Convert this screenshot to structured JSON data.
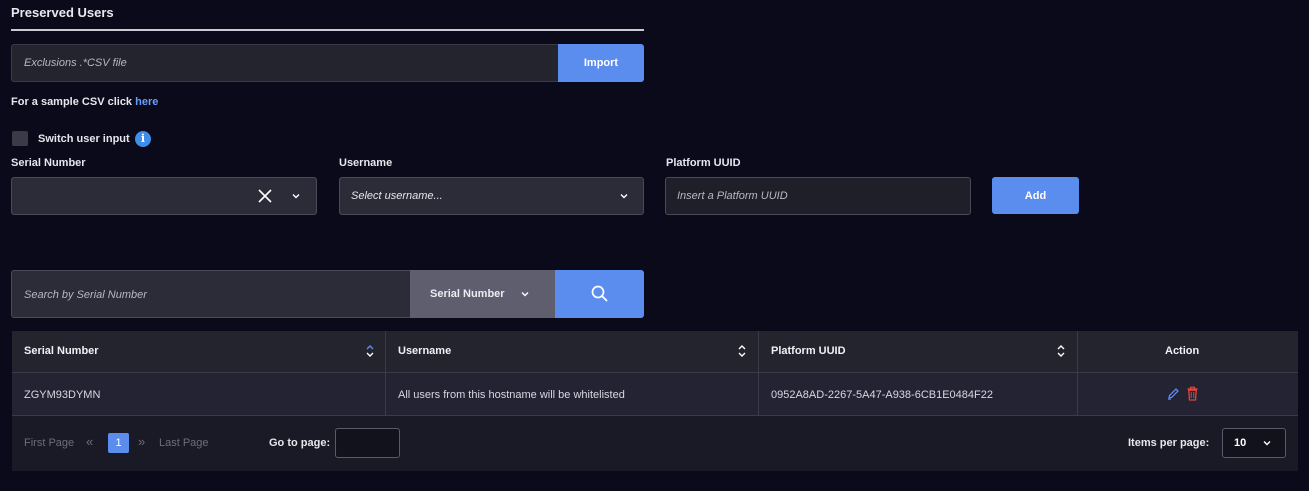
{
  "section": {
    "title": "Preserved Users"
  },
  "import": {
    "file_placeholder": "Exclusions .*CSV file",
    "button_label": "Import",
    "sample_text": "For a sample CSV click",
    "sample_link": "here"
  },
  "switch_input": {
    "label": "Switch user input",
    "checked": false,
    "info_icon": "info-icon"
  },
  "form": {
    "serial_label": "Serial Number",
    "serial_value": "",
    "username_label": "Username",
    "username_placeholder": "Select username...",
    "uuid_label": "Platform UUID",
    "uuid_placeholder": "Insert a Platform UUID",
    "add_label": "Add"
  },
  "search": {
    "placeholder": "Search by Serial Number",
    "type_label": "Serial Number"
  },
  "table": {
    "headers": [
      "Serial Number",
      "Username",
      "Platform UUID",
      "Action"
    ],
    "rows": [
      {
        "serial": "ZGYM93DYMN",
        "username": "All users from this hostname will be whitelisted",
        "uuid": "0952A8AD-2267-5A47-A938-6CB1E0484F22"
      }
    ]
  },
  "pagination": {
    "first_label": "First Page",
    "last_label": "Last Page",
    "current_page": "1",
    "goto_label": "Go to page:",
    "items_per_page_label": "Items per page:",
    "items_per_page_value": "10"
  },
  "colors": {
    "accent": "#5b8def",
    "background": "#0a0a1a",
    "delete": "#e0453d"
  }
}
